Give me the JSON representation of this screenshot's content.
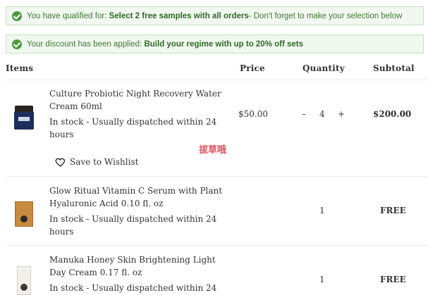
{
  "notices": [
    {
      "prefix": "You have qualified for:",
      "highlight": "Select 2 free samples with all orders",
      "suffix": " - Don't forget to make your selection below"
    },
    {
      "prefix": "Your discount has been applied:",
      "highlight": "Build your regime with up to 20% off sets",
      "suffix": ""
    }
  ],
  "table": {
    "headers": {
      "items": "Items",
      "price": "Price",
      "quantity": "Quantity",
      "subtotal": "Subtotal"
    }
  },
  "items": [
    {
      "name_line1": "Culture Probiotic Night Recovery Water",
      "name_line2": "Cream 60ml",
      "stock_line1": "In stock  -  Usually dispatched within 24",
      "stock_line2": "hours",
      "price": "$50.00",
      "qty_minus": "–",
      "quantity": "4",
      "qty_plus": "+",
      "subtotal": "$200.00",
      "wishlist": "Save to Wishlist"
    },
    {
      "name_line1": "Glow Ritual Vitamin C Serum with Plant",
      "name_line2": "Hyaluronic Acid 0.10 fl. oz",
      "stock_line1": "In stock  -  Usually dispatched within 24",
      "stock_line2": "hours",
      "quantity": "1",
      "subtotal": "FREE"
    },
    {
      "name_line1": "Manuka Honey Skin Brightening Light",
      "name_line2": "Day Cream 0.17 fl. oz",
      "stock_line1": "In stock  -  Usually dispatched within 24",
      "quantity": "1",
      "subtotal": "FREE"
    }
  ],
  "watermark": "拔草哦",
  "colors": {
    "notice_bg": "#f1f8f0",
    "notice_text": "#3f7a34",
    "check": "#4a9a3d",
    "watermark": "#e0505e"
  }
}
